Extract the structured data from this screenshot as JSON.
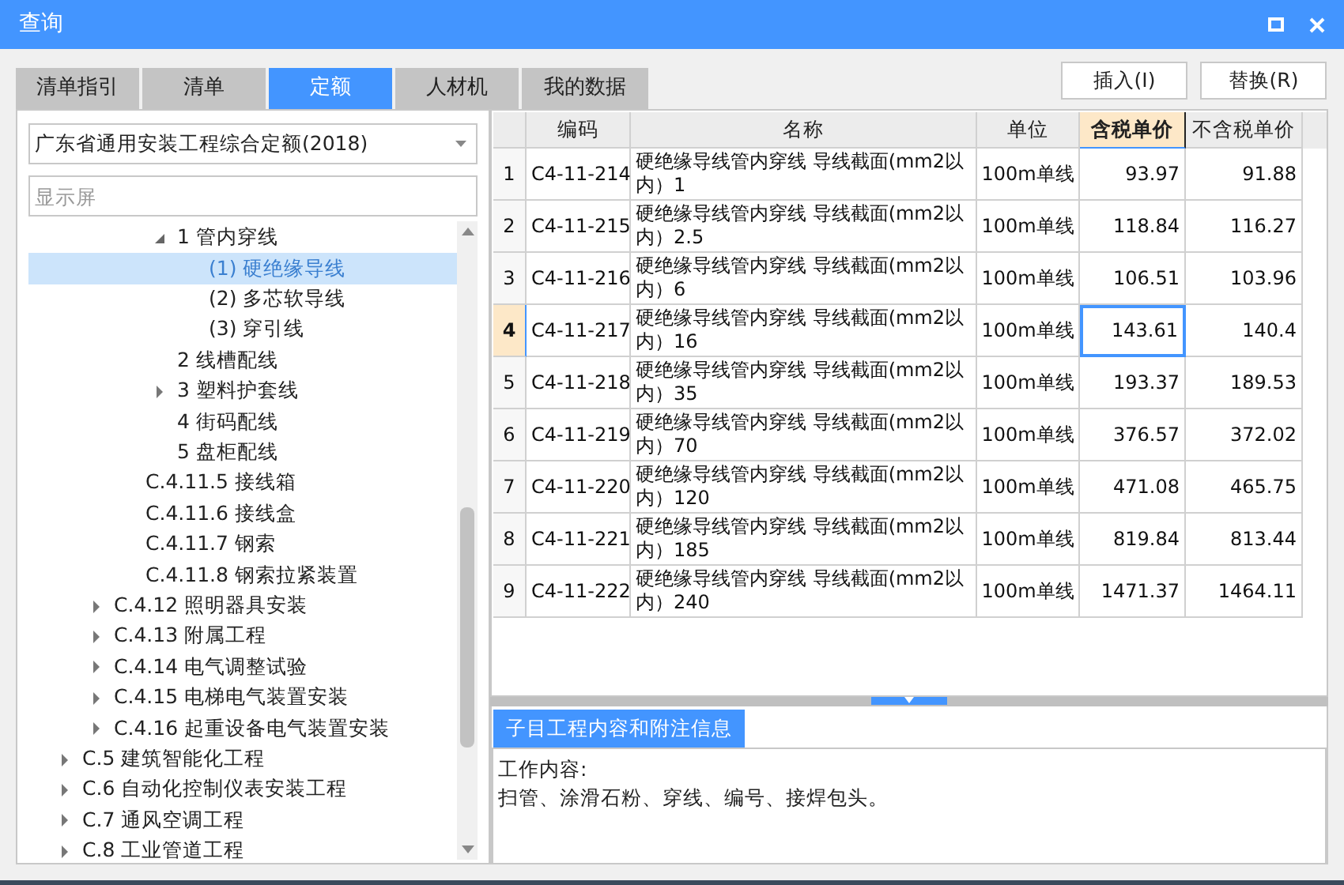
{
  "window": {
    "title": "查询"
  },
  "tabs": [
    {
      "label": "清单指引",
      "selected": false
    },
    {
      "label": "清单",
      "selected": false
    },
    {
      "label": "定额",
      "selected": true
    },
    {
      "label": "人材机",
      "selected": false
    },
    {
      "label": "我的数据",
      "selected": false
    }
  ],
  "buttons": [
    "插入(I)",
    "替换(R)"
  ],
  "library_select": {
    "value": "广东省通用安装工程综合定额(2018)"
  },
  "search": {
    "placeholder": "显示屏"
  },
  "tree": [
    {
      "children": [
        {
          "children": [
            {
              "children": [
                {
                  "label": "1 管内穿线",
                  "selected": false,
                  "expanded": true,
                  "children": [
                    {
                      "label": "(1) 硬绝缘导线",
                      "selected": true
                    },
                    {
                      "label": "(2) 多芯软导线",
                      "selected": false
                    },
                    {
                      "label": "(3) 穿引线",
                      "selected": false
                    }
                  ]
                },
                {
                  "label": "2 线槽配线",
                  "selected": false
                },
                {
                  "label": "3 塑料护套线",
                  "selected": false,
                  "expanded": false
                },
                {
                  "label": "4 街码配线",
                  "selected": false
                },
                {
                  "label": "5 盘柜配线",
                  "selected": false
                }
              ]
            },
            {
              "label": "C.4.11.5 接线箱",
              "selected": false
            },
            {
              "label": "C.4.11.6 接线盒",
              "selected": false
            },
            {
              "label": "C.4.11.7 钢索",
              "selected": false
            },
            {
              "label": "C.4.11.8 钢索拉紧装置",
              "selected": false
            }
          ]
        },
        {
          "label": "C.4.12 照明器具安装",
          "selected": false,
          "expanded": false
        },
        {
          "label": "C.4.13 附属工程",
          "selected": false,
          "expanded": false
        },
        {
          "label": "C.4.14 电气调整试验",
          "selected": false,
          "expanded": false
        },
        {
          "label": "C.4.15 电梯电气装置安装",
          "selected": false,
          "expanded": false
        },
        {
          "label": "C.4.16 起重设备电气装置安装",
          "selected": false,
          "expanded": false
        }
      ]
    },
    {
      "label": "C.5 建筑智能化工程",
      "selected": false,
      "expanded": false
    },
    {
      "label": "C.6 自动化控制仪表安装工程",
      "selected": false,
      "expanded": false
    },
    {
      "label": "C.7 通风空调工程",
      "selected": false,
      "expanded": false
    },
    {
      "label": "C.8 工业管道工程",
      "selected": false,
      "expanded": false
    }
  ],
  "table": {
    "columns": [
      {
        "label": "编码",
        "selected": false
      },
      {
        "label": "名称",
        "selected": false
      },
      {
        "label": "单位",
        "selected": false
      },
      {
        "label": "含税单价",
        "selected": true
      },
      {
        "label": "不含税单价",
        "selected": false
      }
    ],
    "rows": [
      {
        "index": "1",
        "selected": false,
        "cells": [
          "C4-11-214",
          "硬绝缘导线管内穿线 导线截面(mm2以内）1",
          "100m单线",
          "93.97",
          "91.88"
        ]
      },
      {
        "index": "2",
        "selected": false,
        "cells": [
          "C4-11-215",
          "硬绝缘导线管内穿线 导线截面(mm2以内）2.5",
          "100m单线",
          "118.84",
          "116.27"
        ]
      },
      {
        "index": "3",
        "selected": false,
        "cells": [
          "C4-11-216",
          "硬绝缘导线管内穿线 导线截面(mm2以内）6",
          "100m单线",
          "106.51",
          "103.96"
        ]
      },
      {
        "index": "4",
        "selected": true,
        "cells": [
          "C4-11-217",
          "硬绝缘导线管内穿线 导线截面(mm2以内）16",
          "100m单线",
          "143.61",
          "140.4"
        ]
      },
      {
        "index": "5",
        "selected": false,
        "cells": [
          "C4-11-218",
          "硬绝缘导线管内穿线 导线截面(mm2以内）35",
          "100m单线",
          "193.37",
          "189.53"
        ]
      },
      {
        "index": "6",
        "selected": false,
        "cells": [
          "C4-11-219",
          "硬绝缘导线管内穿线 导线截面(mm2以内）70",
          "100m单线",
          "376.57",
          "372.02"
        ]
      },
      {
        "index": "7",
        "selected": false,
        "cells": [
          "C4-11-220",
          "硬绝缘导线管内穿线 导线截面(mm2以内）120",
          "100m单线",
          "471.08",
          "465.75"
        ]
      },
      {
        "index": "8",
        "selected": false,
        "cells": [
          "C4-11-221",
          "硬绝缘导线管内穿线 导线截面(mm2以内）185",
          "100m单线",
          "819.84",
          "813.44"
        ]
      },
      {
        "index": "9",
        "selected": false,
        "cells": [
          "C4-11-222",
          "硬绝缘导线管内穿线 导线截面(mm2以内）240",
          "100m单线",
          "1471.37",
          "1464.11"
        ]
      }
    ]
  },
  "detail": {
    "tab": "子目工程内容和附注信息",
    "lines": [
      "工作内容:",
      "扫管、涂滑石粉、穿线、编号、接焊包头。"
    ]
  }
}
